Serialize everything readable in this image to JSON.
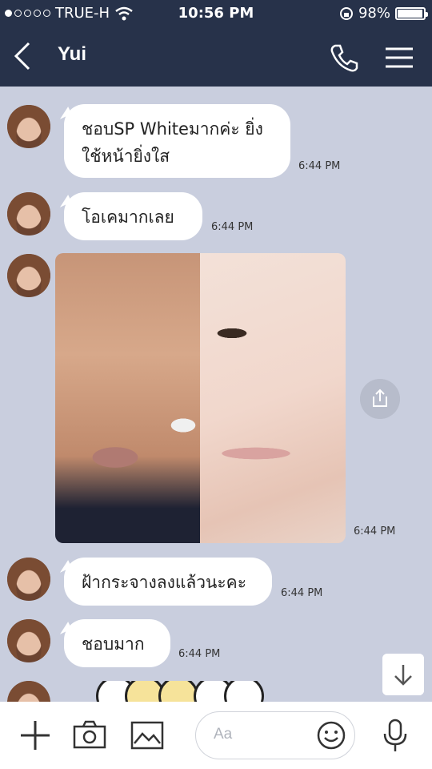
{
  "status": {
    "carrier": "TRUE-H",
    "time": "10:56 PM",
    "battery": "98%",
    "battery_level": 0.98
  },
  "header": {
    "title": "Yui"
  },
  "messages": [
    {
      "text_line1": "ชอบSP Whiteมากค่ะ ยิ่ง",
      "text_line2": "ใช้หน้ายิ่งใส",
      "time": "6:44 PM"
    },
    {
      "text": "โอเคมากเลย",
      "time": "6:44 PM"
    },
    {
      "type": "image",
      "time": "6:44 PM"
    },
    {
      "text": "ฝ้ากระจางลงแล้วนะคะ",
      "time": "6:44 PM"
    },
    {
      "text": "ชอบมาก",
      "time": "6:44 PM"
    }
  ],
  "input": {
    "placeholder": "Aa"
  },
  "icons": [
    "back-icon",
    "call-icon",
    "menu-icon",
    "share-icon",
    "scroll-down-icon",
    "plus-icon",
    "camera-icon",
    "image-icon",
    "emoji-icon",
    "microphone-icon"
  ]
}
